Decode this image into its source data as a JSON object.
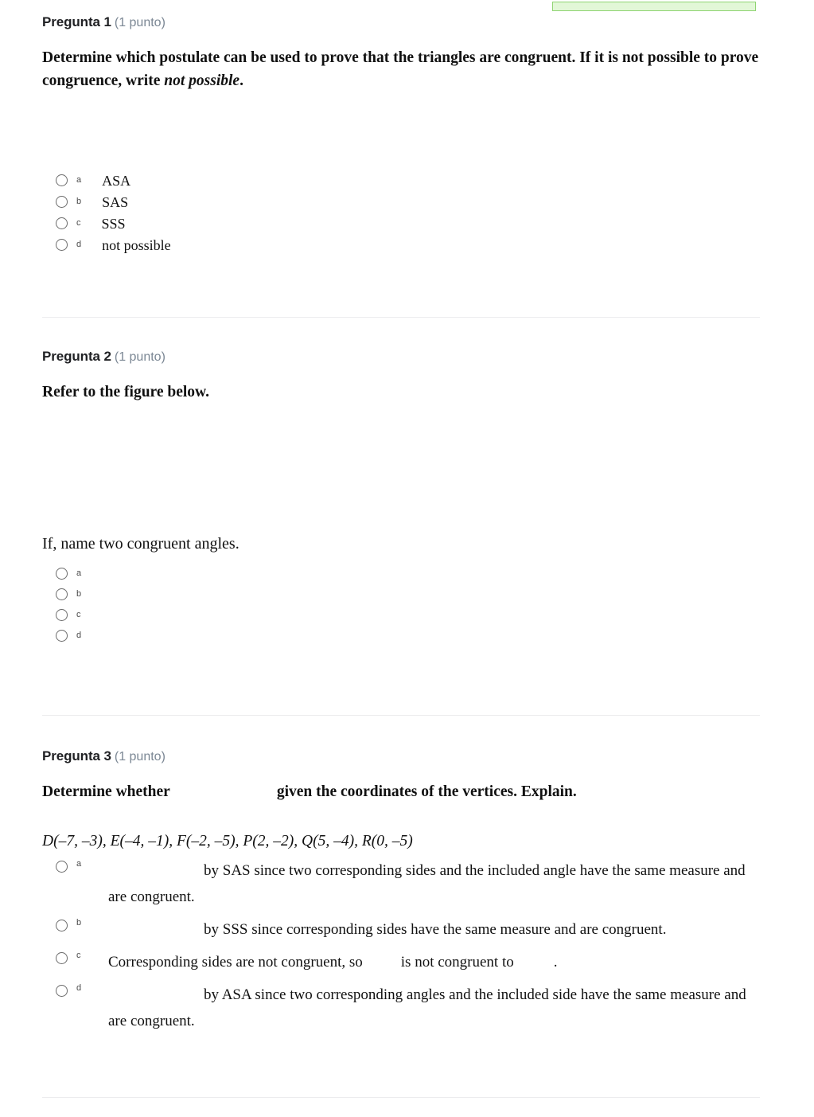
{
  "progress": {
    "score_bar_color": "#e2f7d7",
    "score_bar_border_color": "#8fd472"
  },
  "questions": [
    {
      "label": "Pregunta 1",
      "points": "(1 punto)",
      "prompt_part1": "Determine which postulate can be used to prove that the triangles are congruent. If it is not possible to prove congruence, write ",
      "prompt_emphasis": "not possible",
      "prompt_part2": ".",
      "options": [
        {
          "letter": "a",
          "text": "ASA"
        },
        {
          "letter": "b",
          "text": "SAS"
        },
        {
          "letter": "c",
          "text": "SSS"
        },
        {
          "letter": "d",
          "text": "not possible"
        }
      ]
    },
    {
      "label": "Pregunta 2",
      "points": "(1 punto)",
      "prompt": "Refer to the figure below.",
      "subprompt_part1": "If",
      "subprompt_part2": ", name two congruent angles.",
      "options": [
        {
          "letter": "a",
          "text": ""
        },
        {
          "letter": "b",
          "text": ""
        },
        {
          "letter": "c",
          "text": ""
        },
        {
          "letter": "d",
          "text": ""
        }
      ]
    },
    {
      "label": "Pregunta 3",
      "points": "(1 punto)",
      "prompt_part1": "Determine whether",
      "prompt_part2": "given the coordinates of the vertices. Explain.",
      "coordinates": "D(–7, –3), E(–4, –1), F(–2, –5), P(2, –2), Q(5, –4), R(0, –5)",
      "options": [
        {
          "letter": "a",
          "lead_gap": true,
          "text": "by SAS since two corresponding sides and the included angle have the same measure and are congruent."
        },
        {
          "letter": "b",
          "lead_gap": true,
          "text": "by SSS since corresponding sides have the same measure and are congruent."
        },
        {
          "letter": "c",
          "lead_gap": false,
          "text_a": "Corresponding sides are not congruent, so",
          "text_b": "is not congruent to",
          "text_c": "."
        },
        {
          "letter": "d",
          "lead_gap": true,
          "text": "by ASA since two corresponding angles and the included side have the same measure and are congruent."
        }
      ]
    }
  ]
}
